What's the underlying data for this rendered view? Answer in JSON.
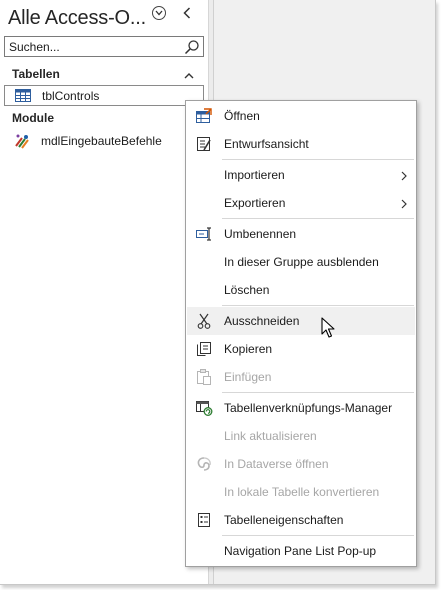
{
  "nav_pane": {
    "title": "Alle Access-O...",
    "search": {
      "placeholder": "Suchen..."
    },
    "groups": [
      {
        "label": "Tabellen",
        "items": [
          {
            "label": "tblControls",
            "icon": "table-icon",
            "selected": true
          }
        ]
      },
      {
        "label": "Module",
        "items": [
          {
            "label": "mdlEingebauteBefehle",
            "icon": "module-icon",
            "selected": false
          }
        ]
      }
    ]
  },
  "context_menu": {
    "items": [
      {
        "label": "Öffnen",
        "icon": "open-table-icon",
        "enabled": true
      },
      {
        "label": "Entwurfsansicht",
        "icon": "design-view-icon",
        "enabled": true
      },
      {
        "label": "Importieren",
        "icon": "",
        "enabled": true,
        "submenu": true
      },
      {
        "label": "Exportieren",
        "icon": "",
        "enabled": true,
        "submenu": true
      },
      {
        "label": "Umbenennen",
        "icon": "rename-icon",
        "enabled": true
      },
      {
        "label": "In dieser Gruppe ausblenden",
        "icon": "",
        "enabled": true
      },
      {
        "label": "Löschen",
        "icon": "",
        "enabled": true
      },
      {
        "label": "Ausschneiden",
        "icon": "scissors-icon",
        "enabled": true,
        "hovered": true
      },
      {
        "label": "Kopieren",
        "icon": "copy-icon",
        "enabled": true
      },
      {
        "label": "Einfügen",
        "icon": "paste-icon",
        "enabled": false
      },
      {
        "label": "Tabellenverknüpfungs-Manager",
        "icon": "linked-table-manager-icon",
        "enabled": true
      },
      {
        "label": "Link aktualisieren",
        "icon": "",
        "enabled": false
      },
      {
        "label": "In Dataverse öffnen",
        "icon": "dataverse-icon",
        "enabled": false
      },
      {
        "label": "In lokale Tabelle konvertieren",
        "icon": "",
        "enabled": false
      },
      {
        "label": "Tabelleneigenschaften",
        "icon": "table-properties-icon",
        "enabled": true
      },
      {
        "label": "Navigation Pane List Pop-up",
        "icon": "",
        "enabled": true
      }
    ]
  }
}
